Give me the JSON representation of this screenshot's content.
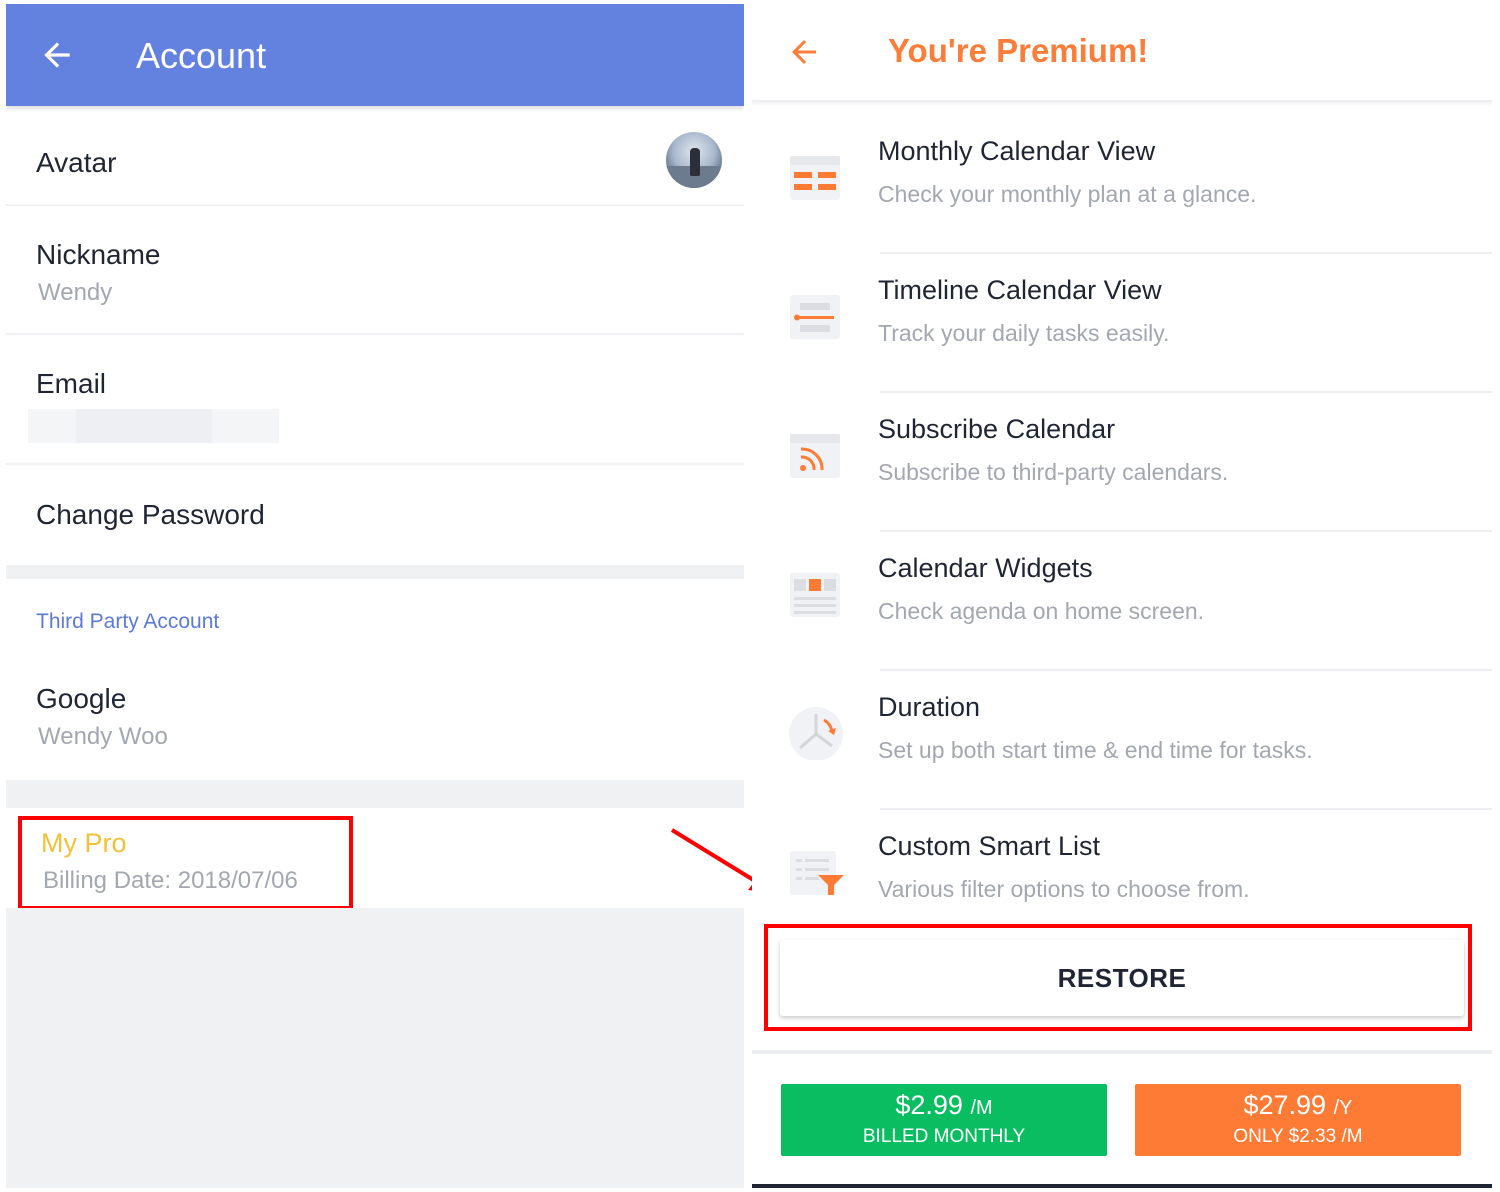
{
  "account": {
    "title": "Account",
    "avatar_label": "Avatar",
    "nickname_label": "Nickname",
    "nickname_value": "Wendy",
    "email_label": "Email",
    "change_password_label": "Change Password",
    "third_party_header": "Third Party Account",
    "google_label": "Google",
    "google_value": "Wendy Woo",
    "pro_title": "My Pro",
    "pro_billing": "Billing Date: 2018/07/06"
  },
  "premium": {
    "title": "You're Premium!",
    "features": [
      {
        "title": "Monthly Calendar View",
        "desc": "Check your monthly plan at a glance.",
        "icon": "monthly-calendar-icon"
      },
      {
        "title": "Timeline Calendar View",
        "desc": "Track your daily tasks easily.",
        "icon": "timeline-icon"
      },
      {
        "title": "Subscribe Calendar",
        "desc": "Subscribe to third-party calendars.",
        "icon": "rss-icon"
      },
      {
        "title": "Calendar Widgets",
        "desc": "Check agenda on home screen.",
        "icon": "widget-icon"
      },
      {
        "title": "Duration",
        "desc": "Set up both start time & end time for tasks.",
        "icon": "clock-icon"
      },
      {
        "title": "Custom Smart List",
        "desc": "Various filter options to choose from.",
        "icon": "filter-list-icon"
      }
    ],
    "restore_label": "RESTORE",
    "monthly": {
      "price": "$2.99",
      "unit": "/M",
      "note": "BILLED MONTHLY"
    },
    "yearly": {
      "price": "$27.99",
      "unit": "/Y",
      "note": "ONLY $2.33 /M"
    }
  },
  "colors": {
    "account_bar": "#6382e0",
    "premium_accent": "#fa7d3a",
    "pro_yellow": "#f2c13a",
    "monthly_green": "#0abd61",
    "yearly_orange": "#fd7b35",
    "highlight_red": "#ff0000"
  }
}
